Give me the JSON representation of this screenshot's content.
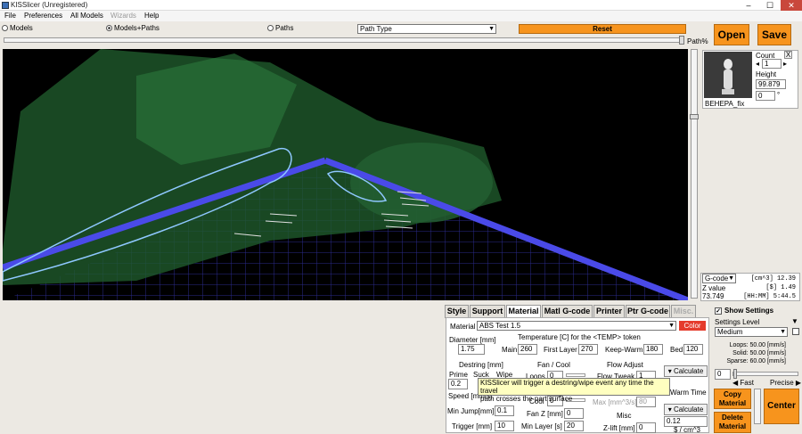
{
  "window": {
    "title": "KISSlicer (Unregistered)",
    "controls": [
      "–",
      "☐",
      "✕"
    ]
  },
  "menu": [
    "File",
    "Preferences",
    "All Models",
    "Wizards",
    "Help"
  ],
  "view_options": {
    "models": "Models",
    "models_paths": "Models+Paths",
    "paths": "Paths",
    "path_type": "Path Type",
    "reset": "Reset",
    "path_pct": "Path%"
  },
  "buttons": {
    "open": "Open",
    "save": "Save"
  },
  "model": {
    "count_label": "Count",
    "count": "1",
    "height_label": "Height",
    "height": "99.879",
    "rotation": "0",
    "deg": "°",
    "name": "BEHEPA_fix",
    "x": "X"
  },
  "gcode": {
    "select": "G-code",
    "z_label": "Z value",
    "z_value": "73.749",
    "lines": [
      "[cm^3] 12.39",
      "[$] 1.49",
      "[HH:MM] 5:44.5"
    ]
  },
  "tabs": [
    "Style",
    "Support",
    "Material",
    "Matl G-code",
    "Printer",
    "Ptr G-code",
    "Misc."
  ],
  "material": {
    "label": "Material",
    "value": "ABS Test 1.5",
    "color": "Color",
    "diameter_label": "Diameter [mm]",
    "diameter": "1.75",
    "temp_title": "Temperature [C] for the <TEMP> token",
    "main_label": "Main",
    "main": "260",
    "first_layer_label": "First Layer",
    "first_layer": "270",
    "keep_warm_label": "Keep-Warm",
    "keep_warm": "180",
    "bed_label": "Bed",
    "bed": "120",
    "destring_label": "Destring [mm]",
    "prime_label": "Prime",
    "suck_label": "Suck",
    "wipe_label": "Wipe",
    "prime": "0.2",
    "speed_label": "Speed [mm/s]",
    "min_jump_label": "Min Jump[mm]",
    "min_jump": "0.1",
    "trigger_label": "Trigger [mm]",
    "trigger": "10",
    "fan_label": "Fan / Cool",
    "loops_label": "Loops",
    "loops": "0",
    "cool_label": "Cool",
    "cool": "0",
    "fan_z_label": "Fan Z [mm]",
    "fan_z": "0",
    "min_layer_label": "Min Layer [s]",
    "min_layer": "20",
    "flow_label": "Flow Adjust",
    "flow_tweak_label": "Flow Tweak",
    "flow_tweak": "1",
    "warm_time_label": "Warm Time",
    "max_label": "Max [mm^3/s]",
    "max": "80",
    "misc_label": "Misc",
    "z_lift_label": "Z-lift [mm]",
    "z_lift": "0",
    "calculate": "Calculate",
    "cost": "0.12",
    "cost_unit": "$ / cm^3",
    "tooltip_line1": "KISSlicer will trigger a destring/wipe event any time the travel",
    "tooltip_line2": "path crosses the part surface"
  },
  "settings": {
    "show_settings": "Show Settings",
    "level_label": "Settings Level",
    "level": "Medium",
    "loops_speed": "Loops: 50.00 [mm/s]",
    "solid_speed": "Solid: 50.00 [mm/s]",
    "sparse_speed": "Sparse: 60.00 [mm/s]",
    "slider_value": "0",
    "fast": "Fast",
    "precise": "Precise",
    "copy_material": "Copy Material",
    "delete_material": "Delete Material",
    "center": "Center"
  },
  "colors": {
    "accent": "#f7941d",
    "bed_edge": "#4a4ae8",
    "model": "#1f5a2c",
    "viewport_bg": "#000000",
    "tooltip": "#ffffc0"
  }
}
